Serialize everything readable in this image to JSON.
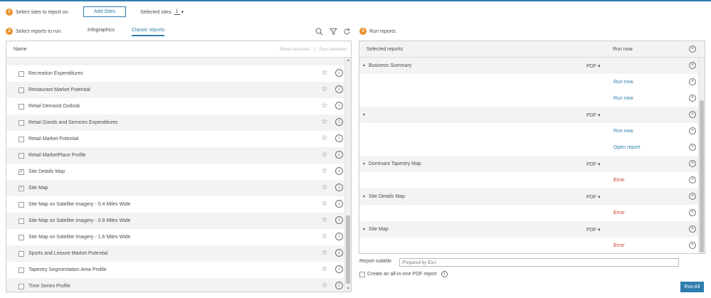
{
  "steps": {
    "one": {
      "num": "1",
      "text": "Select sites to report on."
    },
    "two": {
      "num": "2",
      "text": "Select reports to run."
    },
    "three": {
      "num": "3",
      "text": "Run reports."
    }
  },
  "add_sites_label": "Add Sites",
  "selected_sites": {
    "label": "Selected sites",
    "count": "1",
    "caret": "▾"
  },
  "tabs": {
    "infographics": "Infographics",
    "classic": "Classic reports"
  },
  "left_header": {
    "name": "Name",
    "show_fav": "Show favorites",
    "sep": "|",
    "run_fav": "Run favorites"
  },
  "report_list": [
    {
      "label": "Recreation Expenditures",
      "checked": false
    },
    {
      "label": "Restaurant Market Potential",
      "checked": false
    },
    {
      "label": "Retail Demand Outlook",
      "checked": false
    },
    {
      "label": "Retail Goods and Services Expenditures",
      "checked": false
    },
    {
      "label": "Retail Market Potential",
      "checked": false
    },
    {
      "label": "Retail MarketPlace Profile",
      "checked": false
    },
    {
      "label": "Site Details Map",
      "checked": true
    },
    {
      "label": "Site Map",
      "checked": true
    },
    {
      "label": "Site Map on Satellite Imagery - 0.4 Miles Wide",
      "checked": false
    },
    {
      "label": "Site Map on Satellite Imagery - 0.8 Miles Wide",
      "checked": false
    },
    {
      "label": "Site Map on Satellite Imagery - 1.6 Miles Wide",
      "checked": false
    },
    {
      "label": "Sports and Leisure Market Potential",
      "checked": false
    },
    {
      "label": "Tapestry Segmentation Area Profile",
      "checked": false
    },
    {
      "label": "Time Series Profile",
      "checked": false
    }
  ],
  "right_header": {
    "selected": "Selected reports",
    "run_now": "Run now"
  },
  "selected_reports": [
    {
      "kind": "group",
      "title": "Business Summary",
      "format": "PDF"
    },
    {
      "kind": "sub",
      "link": "Run now",
      "status": "ok"
    },
    {
      "kind": "sub",
      "link": "Run now",
      "status": "ok"
    },
    {
      "kind": "group",
      "title": "",
      "format": "PDF"
    },
    {
      "kind": "sub",
      "link": "Run now",
      "status": "ok"
    },
    {
      "kind": "sub",
      "link": "Open report",
      "status": "ok"
    },
    {
      "kind": "group",
      "title": "Dominant Tapestry Map",
      "format": "PDF"
    },
    {
      "kind": "sub",
      "link": "Error",
      "status": "error"
    },
    {
      "kind": "group",
      "title": "Site Details Map",
      "format": "PDF"
    },
    {
      "kind": "sub",
      "link": "Error",
      "status": "error"
    },
    {
      "kind": "group",
      "title": "Site Map",
      "format": "PDF"
    },
    {
      "kind": "sub",
      "link": "Error",
      "status": "error"
    }
  ],
  "subtitle": {
    "label": "Report subtitle",
    "value": "Prepared by Esri"
  },
  "all_in_one": "Create an all-in-one PDF report",
  "run_all": "Run All",
  "colors": {
    "accent": "#2f7dae",
    "badge": "#e8912d",
    "error": "#c7382b"
  },
  "icons": {
    "search": "search-icon",
    "filter": "filter-icon",
    "refresh": "refresh-icon",
    "star": "star-icon",
    "info": "info-icon",
    "remove": "close-circle-icon"
  }
}
